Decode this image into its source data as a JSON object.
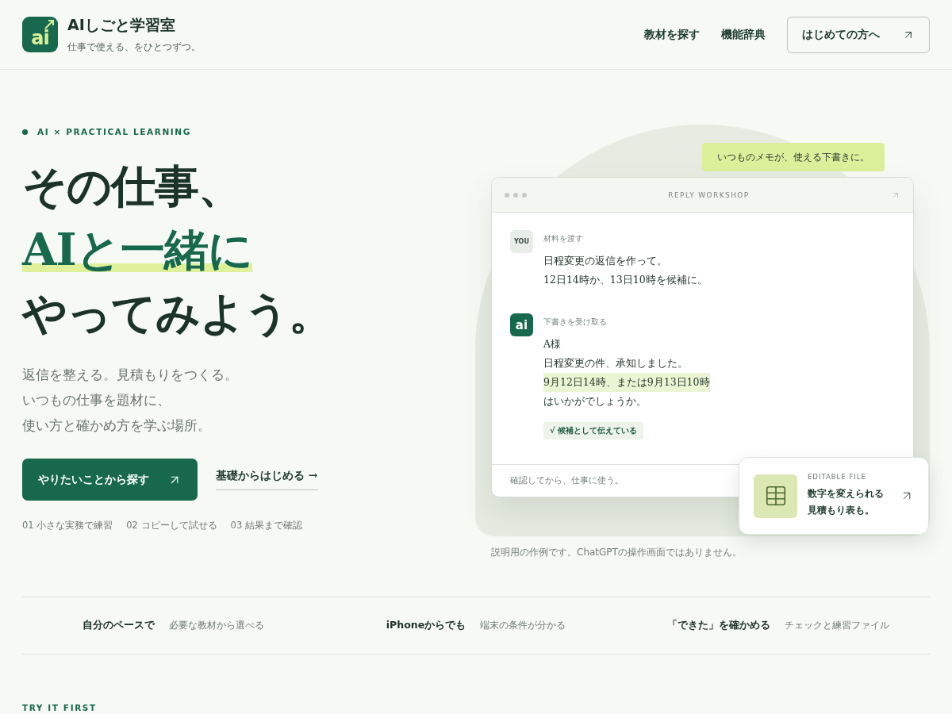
{
  "brand": {
    "logo": "ai",
    "name": "AIしごと学習室",
    "tagline": "仕事で使える、をひとつずつ。"
  },
  "nav": {
    "links": [
      "教材を探す",
      "機能辞典"
    ],
    "cta": "はじめての方へ"
  },
  "hero": {
    "eyebrow": "AI × PRACTICAL LEARNING",
    "title_lines": [
      {
        "text": "その仕事、",
        "highlighted": false
      },
      {
        "text": "AIと一緒に",
        "highlighted": true
      },
      {
        "text": "やってみよう。",
        "highlighted": false
      }
    ],
    "lead_lines": [
      "返信を整える。見積もりをつくる。",
      "いつもの仕事を題材に、",
      "使い方と確かめ方を学ぶ場所。"
    ],
    "primary_button": "やりたいことから探す",
    "secondary_link": "基礎からはじめる →",
    "steps": [
      "01 小さな実務で練習",
      "02 コピーして試せる",
      "03 結果まで確認"
    ]
  },
  "demo": {
    "note": "いつものメモが、使える下書きに。",
    "window_title": "REPLY WORKSHOP",
    "messages": [
      {
        "kind": "user",
        "avatar": "YOU",
        "label": "材料を渡す",
        "lines": [
          {
            "text": "日程変更の返信を作って。",
            "highlighted": false
          },
          {
            "text": "12日14時か、13日10時を候補に。",
            "highlighted": false
          }
        ]
      },
      {
        "kind": "ai",
        "avatar": "ai",
        "label": "下書きを受け取る",
        "lines": [
          {
            "text": "A様",
            "highlighted": false
          },
          {
            "text": "日程変更の件、承知しました。",
            "highlighted": false
          },
          {
            "text": "9月12日14時、または9月13日10時",
            "highlighted": true
          },
          {
            "text": "はいかがでしょうか。",
            "highlighted": false
          }
        ],
        "badge": "√ 候補として伝えている"
      }
    ],
    "footer": "確認してから、仕事に使う。",
    "file_card": {
      "eyebrow": "EDITABLE FILE",
      "title_lines": [
        "数字を変えられる",
        "見積もり表も。"
      ]
    },
    "caption": "説明用の作例です。ChatGPTの操作画面ではありません。"
  },
  "features": [
    {
      "title": "自分のペースで",
      "desc": "必要な教材から選べる"
    },
    {
      "title": "iPhoneからでも",
      "desc": "端末の条件が分かる"
    },
    {
      "title": "「できた」を確かめる",
      "desc": "チェックと練習ファイル"
    }
  ],
  "next_section": {
    "eyebrow": "TRY IT FIRST"
  }
}
